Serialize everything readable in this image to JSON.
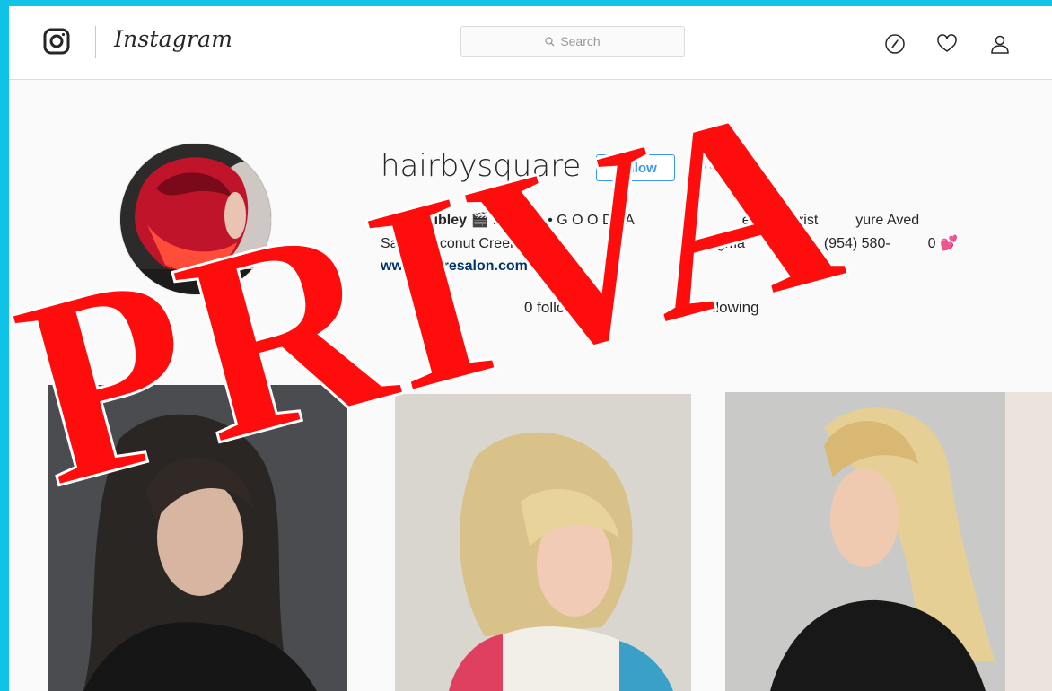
{
  "header": {
    "logo_icon": "instagram-camera-icon",
    "wordmark": "Instagram",
    "search_placeholder": "Search",
    "icons": [
      "compass-icon",
      "heart-icon",
      "person-icon"
    ]
  },
  "profile": {
    "username": "hairbysquare",
    "follow_label": "Follow",
    "more_label": "∘∘∘",
    "bio_name": "Sarah Sibley",
    "bio_line1_rest": " 🎬 M A K E • G O O D • A",
    "bio_line1_tail": "el 5 Colorist",
    "bio_line1_end": "yure Aved",
    "bio_line2a": "Salon Coconut Creek. 💙 h",
    "bio_line2b": "re@gma",
    "bio_line2c": "(954) 580-",
    "bio_line2d": "0 💕",
    "website": "www.pyuresalon.com",
    "stats_a": "0 followers",
    "stats_b": "2 following"
  },
  "overlay": {
    "stamp_text": "PRIVA"
  },
  "colors": {
    "accent": "#3897f0",
    "stamp": "#ff0c0c",
    "frame_bg": "#0fc3e8"
  }
}
